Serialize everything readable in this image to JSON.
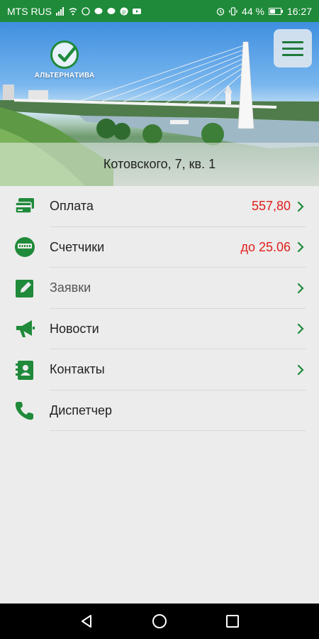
{
  "status_bar": {
    "carrier": "MTS RUS",
    "battery": "44 %",
    "time": "16:27"
  },
  "header": {
    "logo_text": "АЛЬТЕРНАТИВА",
    "address": "Котовского, 7, кв. 1"
  },
  "menu": {
    "items": [
      {
        "label": "Оплата",
        "value": "557,80"
      },
      {
        "label": "Счетчики",
        "value": "до 25.06"
      },
      {
        "label": "Заявки",
        "value": ""
      },
      {
        "label": "Новости",
        "value": ""
      },
      {
        "label": "Контакты",
        "value": ""
      },
      {
        "label": "Диспетчер",
        "value": ""
      }
    ]
  },
  "colors": {
    "brand_green": "#1f8a3a",
    "value_red": "#e0201c"
  },
  "icons": [
    "payment-card-icon",
    "meter-icon",
    "edit-request-icon",
    "megaphone-icon",
    "contacts-book-icon",
    "phone-icon"
  ]
}
